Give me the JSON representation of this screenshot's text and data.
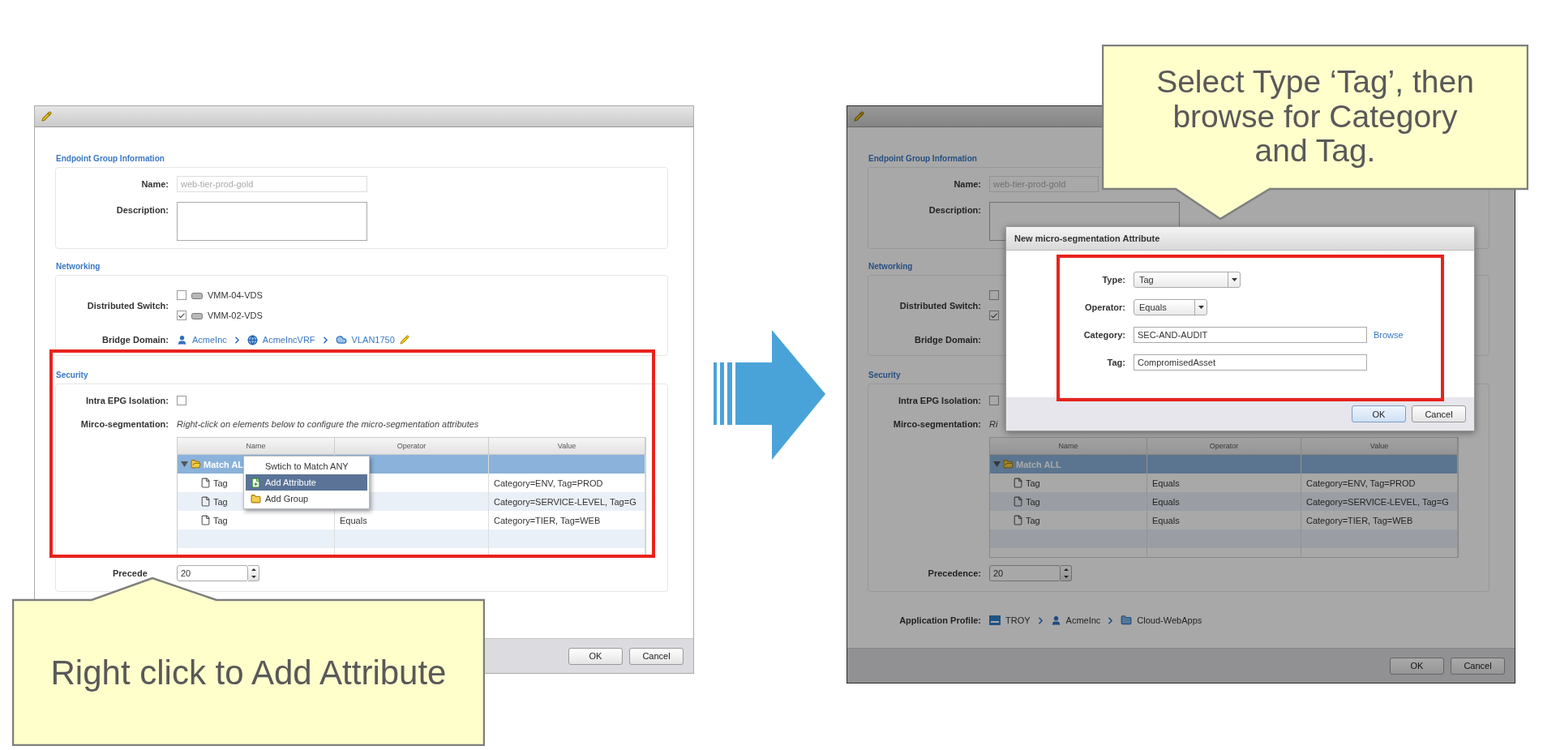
{
  "left_window": {
    "dimmed": false,
    "info_heading": "Endpoint Group Information",
    "name_label": "Name:",
    "name_value": "web-tier-prod-gold",
    "description_label": "Description:",
    "networking_heading": "Networking",
    "switch_label": "Distributed Switch:",
    "switches": [
      {
        "label": "VMM-04-VDS",
        "checked": false
      },
      {
        "label": "VMM-02-VDS",
        "checked": true
      }
    ],
    "bridge_label": "Bridge Domain:",
    "bridge_path": [
      {
        "kind": "tenant",
        "label": "AcmeInc"
      },
      {
        "kind": "vrf",
        "label": "AcmeIncVRF"
      },
      {
        "kind": "bd",
        "label": "VLAN1750"
      }
    ],
    "security_heading": "Security",
    "isolation_label": "Intra EPG Isolation:",
    "isolation_checked": false,
    "microseg_label": "Mirco-segmentation:",
    "microseg_hint": "Right-click on elements below to configure the micro-segmentation attributes",
    "table": {
      "columns": [
        "Name",
        "Operator",
        "Value"
      ],
      "group": {
        "label": "Match AL",
        "expanded": true,
        "selected": true
      },
      "rows": [
        {
          "name": "Tag",
          "value": "Category=ENV, Tag=PROD"
        },
        {
          "name": "Tag",
          "value": "Category=SERVICE-LEVEL, Tag=G"
        },
        {
          "name": "Tag",
          "operator": "Equals",
          "value": "Category=TIER, Tag=WEB"
        }
      ]
    },
    "context_menu": [
      {
        "kind": "plain",
        "label": "Swtich to Match ANY",
        "selected": false
      },
      {
        "kind": "attribute",
        "label": "Add Attribute",
        "selected": true
      },
      {
        "kind": "group",
        "label": "Add Group",
        "selected": false
      }
    ],
    "precedence_label": "Precede",
    "precedence_value": "20",
    "buttons": [
      "OK",
      "Cancel"
    ]
  },
  "right_window": {
    "dimmed": true,
    "info_heading": "Endpoint Group Information",
    "name_label": "Name:",
    "name_value": "web-tier-prod-gold",
    "description_label": "Description:",
    "networking_heading": "Networking",
    "switch_label": "Distributed Switch:",
    "switches": [
      {
        "checked": false
      },
      {
        "checked": true
      }
    ],
    "bridge_label": "Bridge Domain:",
    "security_heading": "Security",
    "isolation_label": "Intra EPG Isolation:",
    "isolation_checked": false,
    "microseg_label": "Mirco-segmentation:",
    "microseg_hint": "Ri",
    "table": {
      "columns": [
        "Name",
        "Operator",
        "Value"
      ],
      "group": {
        "label": "Match ALL",
        "expanded": true,
        "selected": true
      },
      "rows": [
        {
          "name": "Tag",
          "operator": "Equals",
          "value": "Category=ENV, Tag=PROD"
        },
        {
          "name": "Tag",
          "operator": "Equals",
          "value": "Category=SERVICE-LEVEL, Tag=G"
        },
        {
          "name": "Tag",
          "operator": "Equals",
          "value": "Category=TIER, Tag=WEB"
        }
      ]
    },
    "precedence_label": "Precedence:",
    "precedence_value": "20",
    "app_profile_label": "Application Profile:",
    "app_profile_path": [
      {
        "kind": "aci",
        "label": "TROY"
      },
      {
        "kind": "tenant",
        "label": "AcmeInc"
      },
      {
        "kind": "app",
        "label": "Cloud-WebApps"
      }
    ],
    "buttons": [
      "OK",
      "Cancel"
    ],
    "modal": {
      "title": "New micro-segmentation Attribute",
      "fields": [
        {
          "kind": "select",
          "label": "Type:",
          "value": "Tag"
        },
        {
          "kind": "select",
          "label": "Operator:",
          "value": "Equals"
        },
        {
          "kind": "text",
          "label": "Category:",
          "value": "SEC-AND-AUDIT",
          "link": "Browse"
        },
        {
          "kind": "text",
          "label": "Tag:",
          "value": "CompromisedAsset"
        }
      ],
      "buttons": [
        {
          "label": "OK",
          "default": true
        },
        {
          "label": "Cancel",
          "default": false
        }
      ]
    }
  },
  "callouts": [
    {
      "text": "Right click to Add Attribute",
      "kind": "up"
    },
    {
      "text": "Select Type ‘Tag’, then browse for Category and Tag.",
      "kind": "down"
    }
  ]
}
